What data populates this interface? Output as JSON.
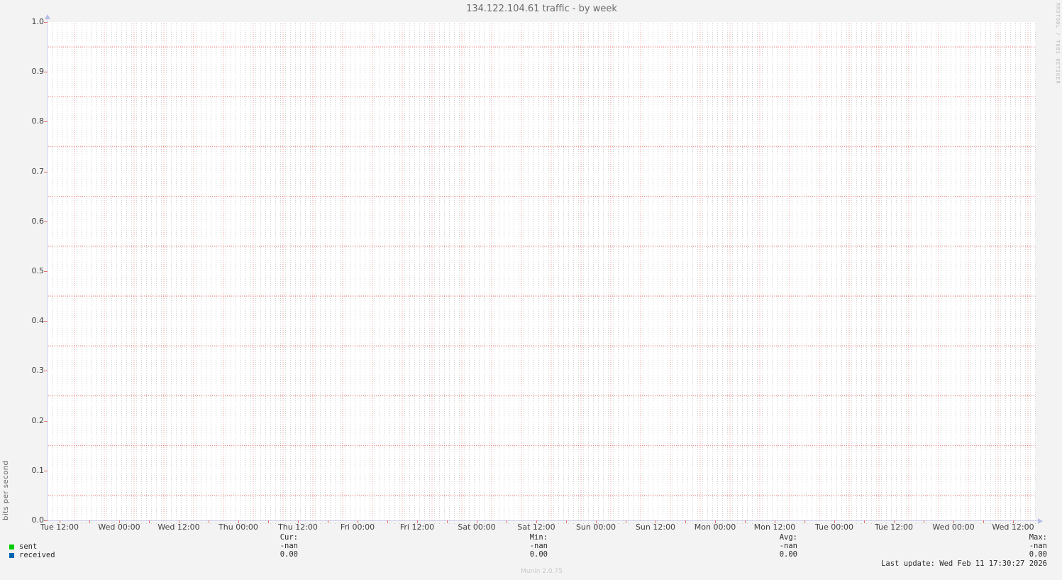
{
  "title": "134.122.104.61 traffic - by week",
  "watermark": "RRDTOOL / TOBI OETIKER",
  "footer": {
    "last_update": "Last update: Wed Feb 11 17:30:27 2026",
    "generator": "Munin 2.0.75"
  },
  "chart_data": {
    "type": "line",
    "title": "134.122.104.61 traffic - by week",
    "xlabel": "",
    "ylabel": "bits per second",
    "ylim": [
      0.0,
      1.0
    ],
    "y_ticks": [
      "0.0",
      "0.1",
      "0.2",
      "0.3",
      "0.4",
      "0.5",
      "0.6",
      "0.7",
      "0.8",
      "0.9",
      "1.0"
    ],
    "x_ticks": [
      "Tue 12:00",
      "Wed 00:00",
      "Wed 12:00",
      "Thu 00:00",
      "Thu 12:00",
      "Fri 00:00",
      "Fri 12:00",
      "Sat 00:00",
      "Sat 12:00",
      "Sun 00:00",
      "Sun 12:00",
      "Mon 00:00",
      "Mon 12:00",
      "Tue 00:00",
      "Tue 12:00",
      "Wed 00:00",
      "Wed 12:00"
    ],
    "grid": true,
    "legend_position": "bottom",
    "series": [
      {
        "name": "sent",
        "color": "#00cc00",
        "values": []
      },
      {
        "name": "received",
        "color": "#0066b3",
        "values": []
      }
    ],
    "stats": {
      "columns": [
        "Cur:",
        "Min:",
        "Avg:",
        "Max:"
      ],
      "rows": [
        {
          "name": "sent",
          "values": [
            "-nan",
            "-nan",
            "-nan",
            "-nan"
          ]
        },
        {
          "name": "received",
          "values": [
            "0.00",
            "0.00",
            "0.00",
            "0.00"
          ]
        }
      ]
    }
  }
}
